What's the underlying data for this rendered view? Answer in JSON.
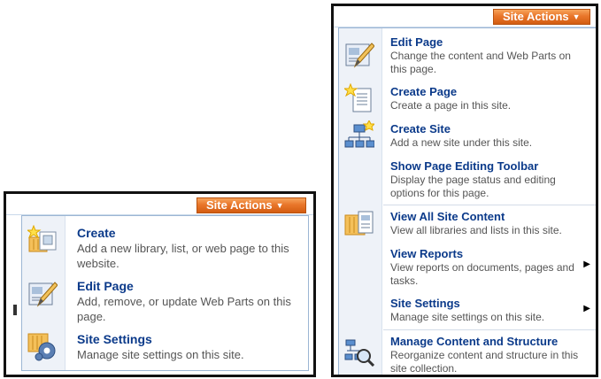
{
  "site_actions_label": "Site Actions",
  "small_menu": {
    "items": [
      {
        "title": "Create",
        "description": "Add a new library, list, or web page to this website."
      },
      {
        "title": "Edit Page",
        "description": "Add, remove, or update Web Parts on this page."
      },
      {
        "title": "Site Settings",
        "description": "Manage site settings on this site."
      }
    ]
  },
  "large_menu": {
    "items": [
      {
        "title": "Edit Page",
        "description": "Change the content and Web Parts on this page."
      },
      {
        "title": "Create Page",
        "description": "Create a page in this site."
      },
      {
        "title": "Create Site",
        "description": "Add a new site under this site."
      },
      {
        "title": "Show Page Editing Toolbar",
        "description": "Display the page status and editing options for this page."
      },
      {
        "title": "View All Site Content",
        "description": "View all libraries and lists in this site."
      },
      {
        "title": "View Reports",
        "description": "View reports on documents, pages and tasks.",
        "has_submenu": true
      },
      {
        "title": "Site Settings",
        "description": "Manage site settings on this site.",
        "has_submenu": true
      },
      {
        "title": "Manage Content and Structure",
        "description": "Reorganize content and structure in this site collection."
      }
    ]
  },
  "colors": {
    "accent": "#e9762a",
    "link": "#0b3a8a",
    "menu_border": "#9cb6d4"
  },
  "icons": [
    "create-icon",
    "edit-page-icon",
    "site-settings-icon",
    "create-page-icon",
    "create-site-icon",
    "view-all-content-icon",
    "manage-content-icon"
  ]
}
